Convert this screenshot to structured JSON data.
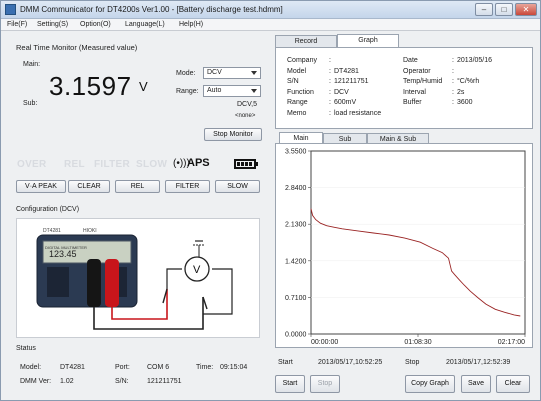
{
  "window": {
    "title": "DMM Communicator for DT4200s  Ver1.00 - [Battery discharge test.hdmm]",
    "controls": [
      "–",
      "□",
      "✕"
    ]
  },
  "menu": [
    "File(F)",
    "Setting(S)",
    "Option(O)",
    "Language(L)",
    "Help(H)"
  ],
  "monitor": {
    "heading": "Real Time Monitor (Measured value)",
    "main_label": "Main:",
    "sub_label": "Sub:",
    "main_value": "3.1597",
    "main_unit": "V",
    "mode_label": "Mode:",
    "mode_value": "DCV",
    "range_label": "Range:",
    "range_value": "Auto",
    "sub_info": "DCV,5",
    "sub_none": "<none>",
    "stop_monitor": "Stop Monitor"
  },
  "indicators": [
    "OVER",
    "REL",
    "FILTER",
    "SLOW"
  ],
  "sound_symbol": "(•)))",
  "aps_label": "APS",
  "func_buttons": [
    "V·A PEAK",
    "CLEAR",
    "REL",
    "FILTER",
    "SLOW"
  ],
  "config": {
    "heading": "Configuration (DCV)",
    "meter_model": "DT4281",
    "meter_brand": "HIOKI",
    "meter_label": "DIGITAL MULTIMETER",
    "display_value": "123.45",
    "dial_symbol": "V",
    "dc_symbol": "⎓"
  },
  "status": {
    "heading": "Status",
    "model_label": "Model:",
    "model_value": "DT4281",
    "port_label": "Port:",
    "port_value": "COM 6",
    "time_label": "Time:",
    "time_value": "09:15:04",
    "ver_label": "DMM Ver:",
    "ver_value": "1.02",
    "sn_label": "S/N:",
    "sn_value": "121211751"
  },
  "right_tabs": [
    "Record",
    "Graph"
  ],
  "info": {
    "rows_left": [
      {
        "label": "Company",
        "value": ""
      },
      {
        "label": "Model",
        "value": "DT4281"
      },
      {
        "label": "S/N",
        "value": "121211751"
      },
      {
        "label": "Function",
        "value": "DCV"
      },
      {
        "label": "Range",
        "value": "600mV"
      },
      {
        "label": "Memo",
        "value": "load resistance"
      }
    ],
    "rows_right": [
      {
        "label": "Date",
        "value": "2013/05/16"
      },
      {
        "label": "Operator",
        "value": ""
      },
      {
        "label": "Temp/Humid",
        "value": "°C/%rh"
      },
      {
        "label": "Interval",
        "value": "2s"
      },
      {
        "label": "Buffer",
        "value": "3600"
      }
    ]
  },
  "graph_tabs": [
    "Main",
    "Sub",
    "Main & Sub"
  ],
  "chart_data": {
    "type": "line",
    "xlabel": "",
    "ylabel": "",
    "x_ticks": [
      "00:00:00",
      "01:08:30",
      "02:17:00"
    ],
    "y_ticks": [
      "3.5500",
      "2.8400",
      "2.1300",
      "1.4200",
      "0.7100",
      "0.0000"
    ],
    "ylim": [
      0,
      3.55
    ],
    "xlim_minutes": [
      0,
      137
    ],
    "series": [
      {
        "color": "#9a2424",
        "x": [
          0,
          1,
          3,
          6,
          10,
          15,
          20,
          30,
          40,
          50,
          60,
          70,
          78,
          84,
          88,
          90,
          92,
          95,
          98,
          102,
          107,
          112,
          118,
          124,
          130,
          134
        ],
        "y": [
          2.43,
          2.3,
          2.22,
          2.15,
          2.1,
          2.07,
          2.04,
          2.0,
          1.96,
          1.92,
          1.86,
          1.78,
          1.66,
          1.58,
          1.47,
          1.22,
          1.15,
          1.05,
          0.95,
          0.83,
          0.7,
          0.58,
          0.48,
          0.42,
          0.37,
          0.35
        ]
      }
    ]
  },
  "start_label": "Start",
  "start_time": "2013/05/17,10:52:25",
  "stop_label": "Stop",
  "stop_time": "2013/05/17,12:52:39",
  "bottom_buttons": [
    "Start",
    "Stop",
    "Copy Graph",
    "Save",
    "Clear"
  ]
}
